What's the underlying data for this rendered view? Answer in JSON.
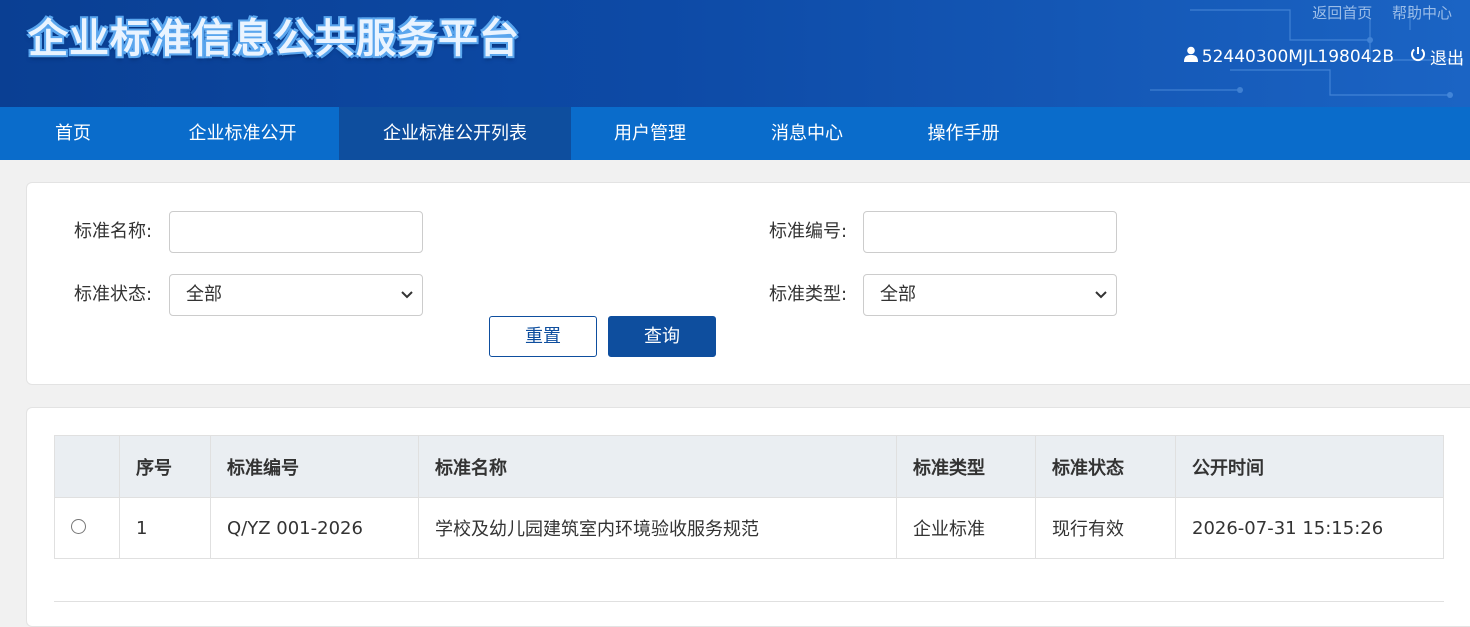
{
  "header": {
    "site_title": "企业标准信息公共服务平台",
    "links": {
      "home": "返回首页",
      "help": "帮助中心"
    },
    "user_id": "52440300MJL198042B",
    "logout": "退出"
  },
  "nav": {
    "items": [
      {
        "label": "首页"
      },
      {
        "label": "企业标准公开"
      },
      {
        "label": "企业标准公开列表",
        "active": true
      },
      {
        "label": "用户管理"
      },
      {
        "label": "消息中心"
      },
      {
        "label": "操作手册"
      }
    ]
  },
  "search": {
    "name_label": "标准名称:",
    "name_value": "",
    "number_label": "标准编号:",
    "number_value": "",
    "status_label": "标准状态:",
    "status_selected": "全部",
    "type_label": "标准类型:",
    "type_selected": "全部",
    "reset_label": "重置",
    "query_label": "查询"
  },
  "table": {
    "columns": [
      "",
      "序号",
      "标准编号",
      "标准名称",
      "标准类型",
      "标准状态",
      "公开时间"
    ],
    "rows": [
      [
        "",
        "1",
        "Q/YZ 001-2026",
        "学校及幼儿园建筑室内环境验收服务规范",
        "企业标准",
        "现行有效",
        "2026-07-31 15:15:26"
      ]
    ]
  },
  "colors": {
    "header_bg": "#0d4aa6",
    "nav_bg": "#0a6ccb",
    "nav_active": "#0e4e9e",
    "primary_button": "#0e4e9e"
  }
}
